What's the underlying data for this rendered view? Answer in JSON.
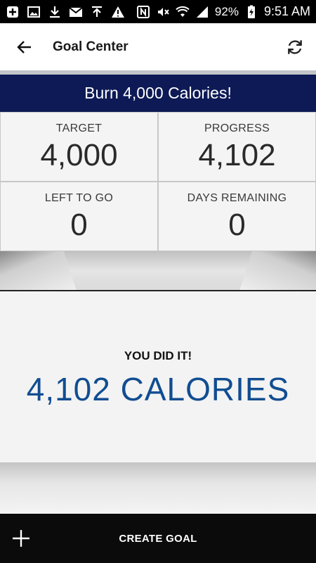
{
  "status_bar": {
    "battery": "92%",
    "time": "9:51 AM",
    "icons_left": [
      "add-box-icon",
      "image-icon",
      "download-icon",
      "gmail-icon",
      "upload-icon",
      "warning-icon"
    ],
    "icons_right": [
      "nfc-icon",
      "mute-icon",
      "wifi-icon",
      "signal-icon",
      "battery-charging-icon"
    ]
  },
  "app_bar": {
    "title": "Goal Center",
    "back_icon": "arrow-left-icon",
    "refresh_icon": "refresh-icon"
  },
  "goal": {
    "title": "Burn 4,000 Calories!",
    "banner_color": "#0d1a55"
  },
  "stats": [
    {
      "label": "TARGET",
      "value": "4,000"
    },
    {
      "label": "PROGRESS",
      "value": "4,102"
    },
    {
      "label": "LEFT TO GO",
      "value": "0"
    },
    {
      "label": "DAYS REMAINING",
      "value": "0"
    }
  ],
  "result": {
    "heading": "YOU DID IT!",
    "value": "4,102 CALORIES",
    "accent_color": "#114d91"
  },
  "bottom_bar": {
    "create_goal_label": "CREATE GOAL",
    "add_icon": "plus-icon"
  }
}
